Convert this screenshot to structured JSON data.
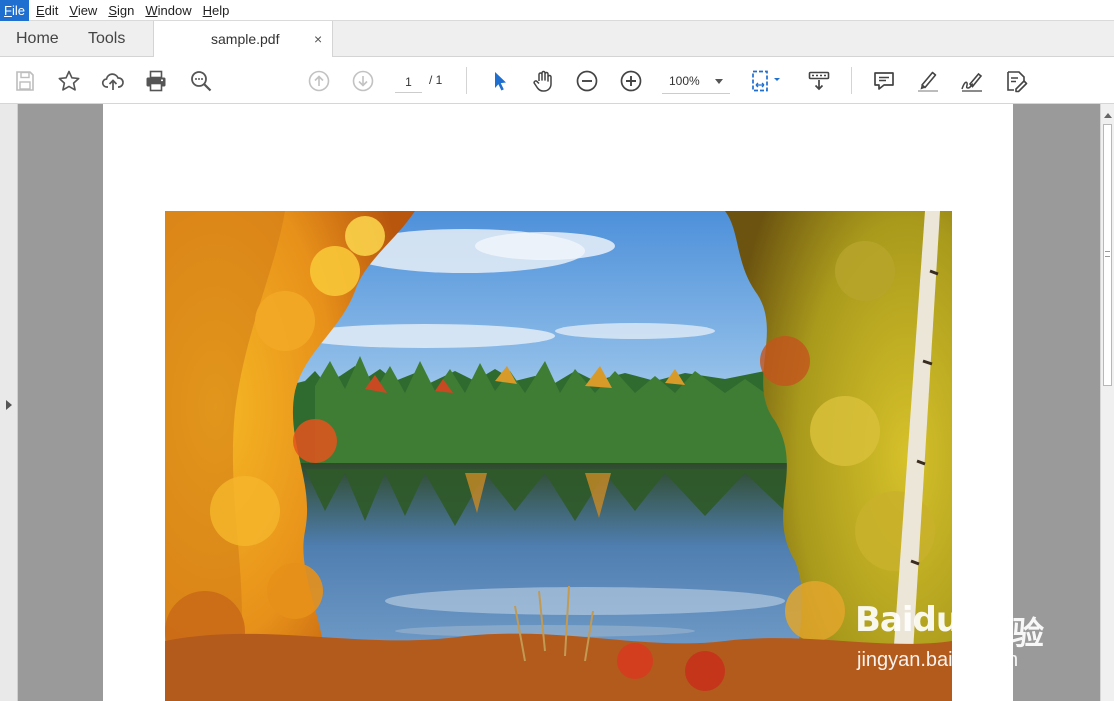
{
  "menu": {
    "items": [
      "File",
      "Edit",
      "View",
      "Sign",
      "Window",
      "Help"
    ]
  },
  "tabs": {
    "home_label": "Home",
    "tools_label": "Tools",
    "document_label": "sample.pdf",
    "close_glyph": "×"
  },
  "toolbar": {
    "icons": [
      "save-icon",
      "bookmark-star-icon",
      "upload-cloud-icon",
      "print-icon",
      "search-zoom-icon",
      "previous-page-icon",
      "next-page-icon",
      "select-pointer-icon",
      "hand-pan-icon",
      "zoom-out-icon",
      "zoom-in-icon",
      "fit-page-icon",
      "scroll-mode-icon",
      "comment-icon",
      "highlight-icon",
      "sign-icon",
      "fill-sign-icon"
    ],
    "page_current": "1",
    "page_total": "/ 1",
    "zoom": "100%",
    "accent_color": "#1e6fd0"
  },
  "document": {
    "image_subject": "autumn lake landscape photo",
    "watermark_brand": "Baidu",
    "watermark_cn": "经验",
    "watermark_url": "jingyan.baidu.com"
  }
}
